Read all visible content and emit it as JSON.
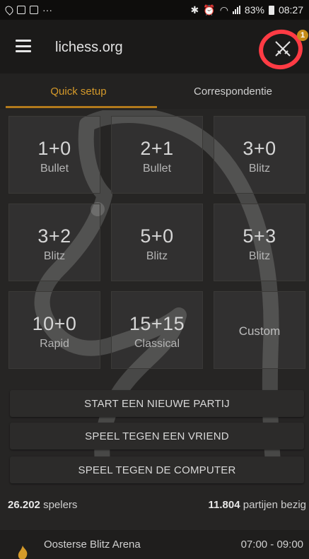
{
  "statusbar": {
    "battery": "83%",
    "time": "08:27",
    "more": "···"
  },
  "header": {
    "title": "lichess.org",
    "notification_count": "1"
  },
  "tabs": [
    {
      "label": "Quick setup",
      "active": true
    },
    {
      "label": "Correspondentie",
      "active": false
    }
  ],
  "presets": [
    {
      "time": "1+0",
      "perf": "Bullet"
    },
    {
      "time": "2+1",
      "perf": "Bullet"
    },
    {
      "time": "3+0",
      "perf": "Blitz"
    },
    {
      "time": "3+2",
      "perf": "Blitz"
    },
    {
      "time": "5+0",
      "perf": "Blitz"
    },
    {
      "time": "5+3",
      "perf": "Blitz"
    },
    {
      "time": "10+0",
      "perf": "Rapid"
    },
    {
      "time": "15+15",
      "perf": "Classical"
    },
    {
      "time": "",
      "perf": "Custom"
    }
  ],
  "actions": {
    "new_game": "START EEN NIEUWE PARTIJ",
    "vs_friend": "SPEEL TEGEN EEN VRIEND",
    "vs_computer": "SPEEL TEGEN DE COMPUTER"
  },
  "stats": {
    "players_count": "26.202",
    "players_label": "spelers",
    "games_count": "11.804",
    "games_label": "partijen bezig"
  },
  "tournament": {
    "name": "Oosterse Blitz Arena",
    "time": "07:00 - 09:00"
  },
  "colors": {
    "accent": "#d59a2a",
    "highlight": "#ff3b44",
    "badge": "#c58d1a"
  }
}
